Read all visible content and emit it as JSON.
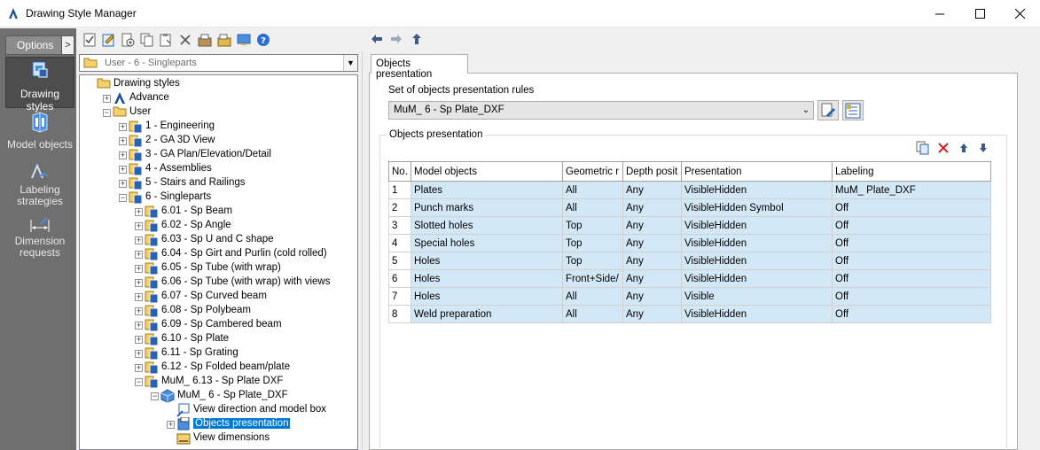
{
  "window": {
    "title": "Drawing Style Manager"
  },
  "leftnav": {
    "options_label": "Options",
    "items": [
      {
        "label": "Drawing styles",
        "icon": "drawing-styles-icon",
        "active": true
      },
      {
        "label": "Model objects",
        "icon": "model-objects-icon",
        "active": false
      },
      {
        "label": "Labeling strategies",
        "icon": "labeling-strategies-icon",
        "active": false
      },
      {
        "label": "Dimension requests",
        "icon": "dimension-requests-icon",
        "active": false
      }
    ]
  },
  "tree_combo": {
    "value": "User - 6 - Singleparts"
  },
  "tree": {
    "root": "Drawing styles",
    "advance": "Advance",
    "user": "User",
    "user_children": [
      "1 - Engineering",
      "2 - GA 3D View",
      "3 - GA Plan/Elevation/Detail",
      "4 - Assemblies",
      "5 - Stairs and Railings",
      "6 - Singleparts"
    ],
    "singleparts_children": [
      "6.01 - Sp Beam",
      "6.02 - Sp Angle",
      "6.03 - Sp U and C shape",
      "6.04 - Sp Girt and Purlin (cold rolled)",
      "6.05 - Sp Tube (with wrap)",
      "6.06 - Sp Tube (with wrap) with views",
      "6.07 - Sp Curved beam",
      "6.08 - Sp Polybeam",
      "6.09 - Sp Cambered beam",
      "6.10 - Sp Plate",
      "6.11 - Sp Grating",
      "6.12 - Sp Folded beam/plate",
      "MuM_ 6.13 - Sp Plate DXF"
    ],
    "mum_child": "MuM_ 6 - Sp Plate_DXF",
    "leaf_items": [
      "View direction and model box",
      "Objects presentation",
      "View dimensions"
    ],
    "selected": "Objects presentation"
  },
  "right": {
    "tab": "Objects presentation",
    "set_label": "Set of objects presentation rules",
    "set_value": "MuM_ 6 - Sp Plate_DXF",
    "group_label": "Objects presentation",
    "columns": [
      "No.",
      "Model objects",
      "Geometric r",
      "Depth posit",
      "Presentation",
      "Labeling"
    ],
    "rows": [
      [
        "1",
        "Plates",
        "All",
        "Any",
        "VisibleHidden",
        "MuM_ Plate_DXF"
      ],
      [
        "2",
        "Punch marks",
        "All",
        "Any",
        "VisibleHidden Symbol",
        "Off"
      ],
      [
        "3",
        "Slotted holes",
        "Top",
        "Any",
        "VisibleHidden",
        "Off"
      ],
      [
        "4",
        "Special holes",
        "Top",
        "Any",
        "VisibleHidden",
        "Off"
      ],
      [
        "5",
        "Holes",
        "Top",
        "Any",
        "VisibleHidden",
        "Off"
      ],
      [
        "6",
        "Holes",
        "Front+Side/",
        "Any",
        "VisibleHidden",
        "Off"
      ],
      [
        "7",
        "Holes",
        "All",
        "Any",
        "Visible",
        "Off"
      ],
      [
        "8",
        "Weld preparation",
        "All",
        "Any",
        "VisibleHidden",
        "Off"
      ]
    ]
  },
  "colors": {
    "selection": "#0078d7",
    "row_highlight": "#d3e8f7",
    "nav_bg": "#6f6f6f"
  }
}
